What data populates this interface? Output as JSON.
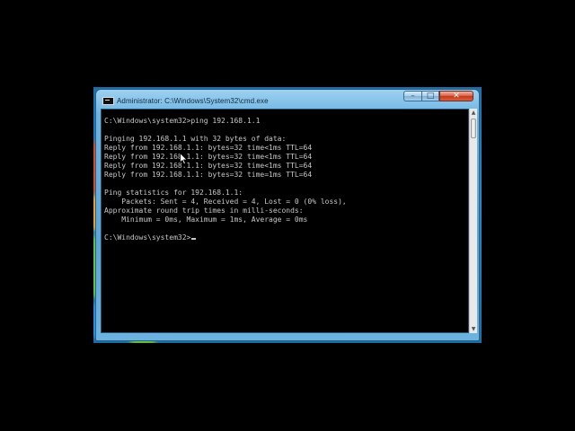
{
  "window": {
    "title": "Administrator: C:\\Windows\\System32\\cmd.exe",
    "controls": {
      "minimize": "–",
      "maximize": "□",
      "close": "✕"
    }
  },
  "console": {
    "lines": [
      "C:\\Windows\\system32>ping 192.168.1.1",
      "",
      "Pinging 192.168.1.1 with 32 bytes of data:",
      "Reply from 192.168.1.1: bytes=32 time<1ms TTL=64",
      "Reply from 192.168.1.1: bytes=32 time<1ms TTL=64",
      "Reply from 192.168.1.1: bytes=32 time<1ms TTL=64",
      "Reply from 192.168.1.1: bytes=32 time=1ms TTL=64",
      "",
      "Ping statistics for 192.168.1.1:",
      "    Packets: Sent = 4, Received = 4, Lost = 0 (0% loss),",
      "Approximate round trip times in milli-seconds:",
      "    Minimum = 0ms, Maximum = 1ms, Average = 0ms",
      "",
      "C:\\Windows\\system32>"
    ]
  },
  "scrollbar": {
    "up_icon": "chevron-up-icon",
    "down_icon": "chevron-down-icon"
  },
  "colors": {
    "console_bg": "#000000",
    "console_text": "#c8c8c8",
    "frame": "#5aa5d9",
    "close_button": "#c5391a"
  }
}
